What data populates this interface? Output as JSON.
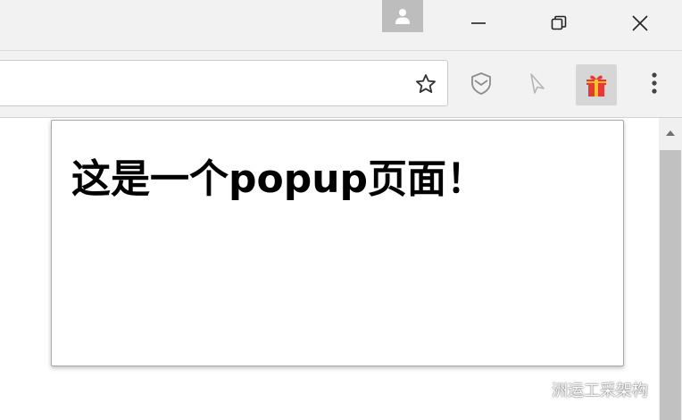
{
  "window": {
    "profile_icon": "person-icon",
    "minimize_icon": "minimize-icon",
    "restore_icon": "restore-icon",
    "close_icon": "close-icon"
  },
  "toolbar": {
    "omnibox_value": "",
    "bookmark_icon": "star-icon",
    "extensions": [
      {
        "icon": "shield-icon"
      },
      {
        "icon": "cursor-icon"
      },
      {
        "icon": "gift-icon",
        "active": true
      }
    ],
    "menu_icon": "three-dots-icon"
  },
  "popup": {
    "heading": "这是一个popup页面！"
  },
  "watermark": {
    "text": "洲运工采架构"
  },
  "colors": {
    "chrome_bg": "#f2f2f2",
    "active_ext_bg": "#d6d6d6",
    "gift_red": "#e53935",
    "gift_yellow": "#fbc02d",
    "scroll_thumb": "#c1c1c1"
  }
}
